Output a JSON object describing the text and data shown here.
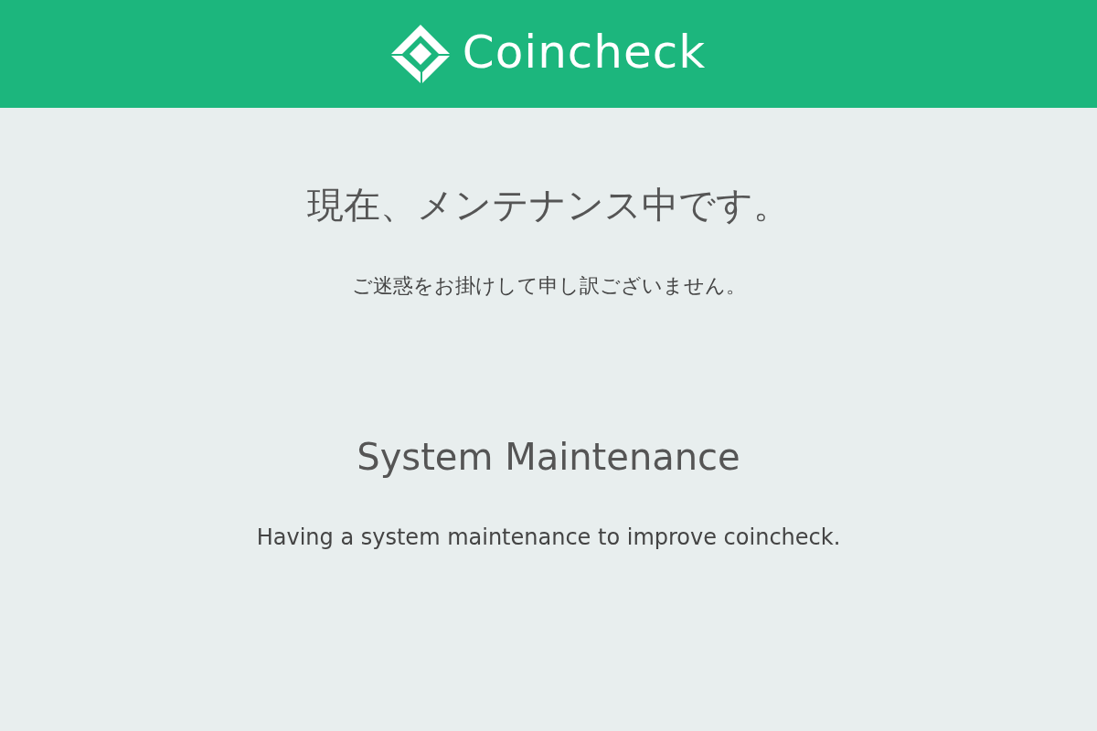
{
  "header": {
    "logo_text": "Coincheck"
  },
  "notice_ja": {
    "title": "現在、メンテナンス中です。",
    "message": "ご迷惑をお掛けして申し訳ございません。"
  },
  "notice_en": {
    "title": "System Maintenance",
    "message": "Having a system maintenance to improve coincheck."
  }
}
